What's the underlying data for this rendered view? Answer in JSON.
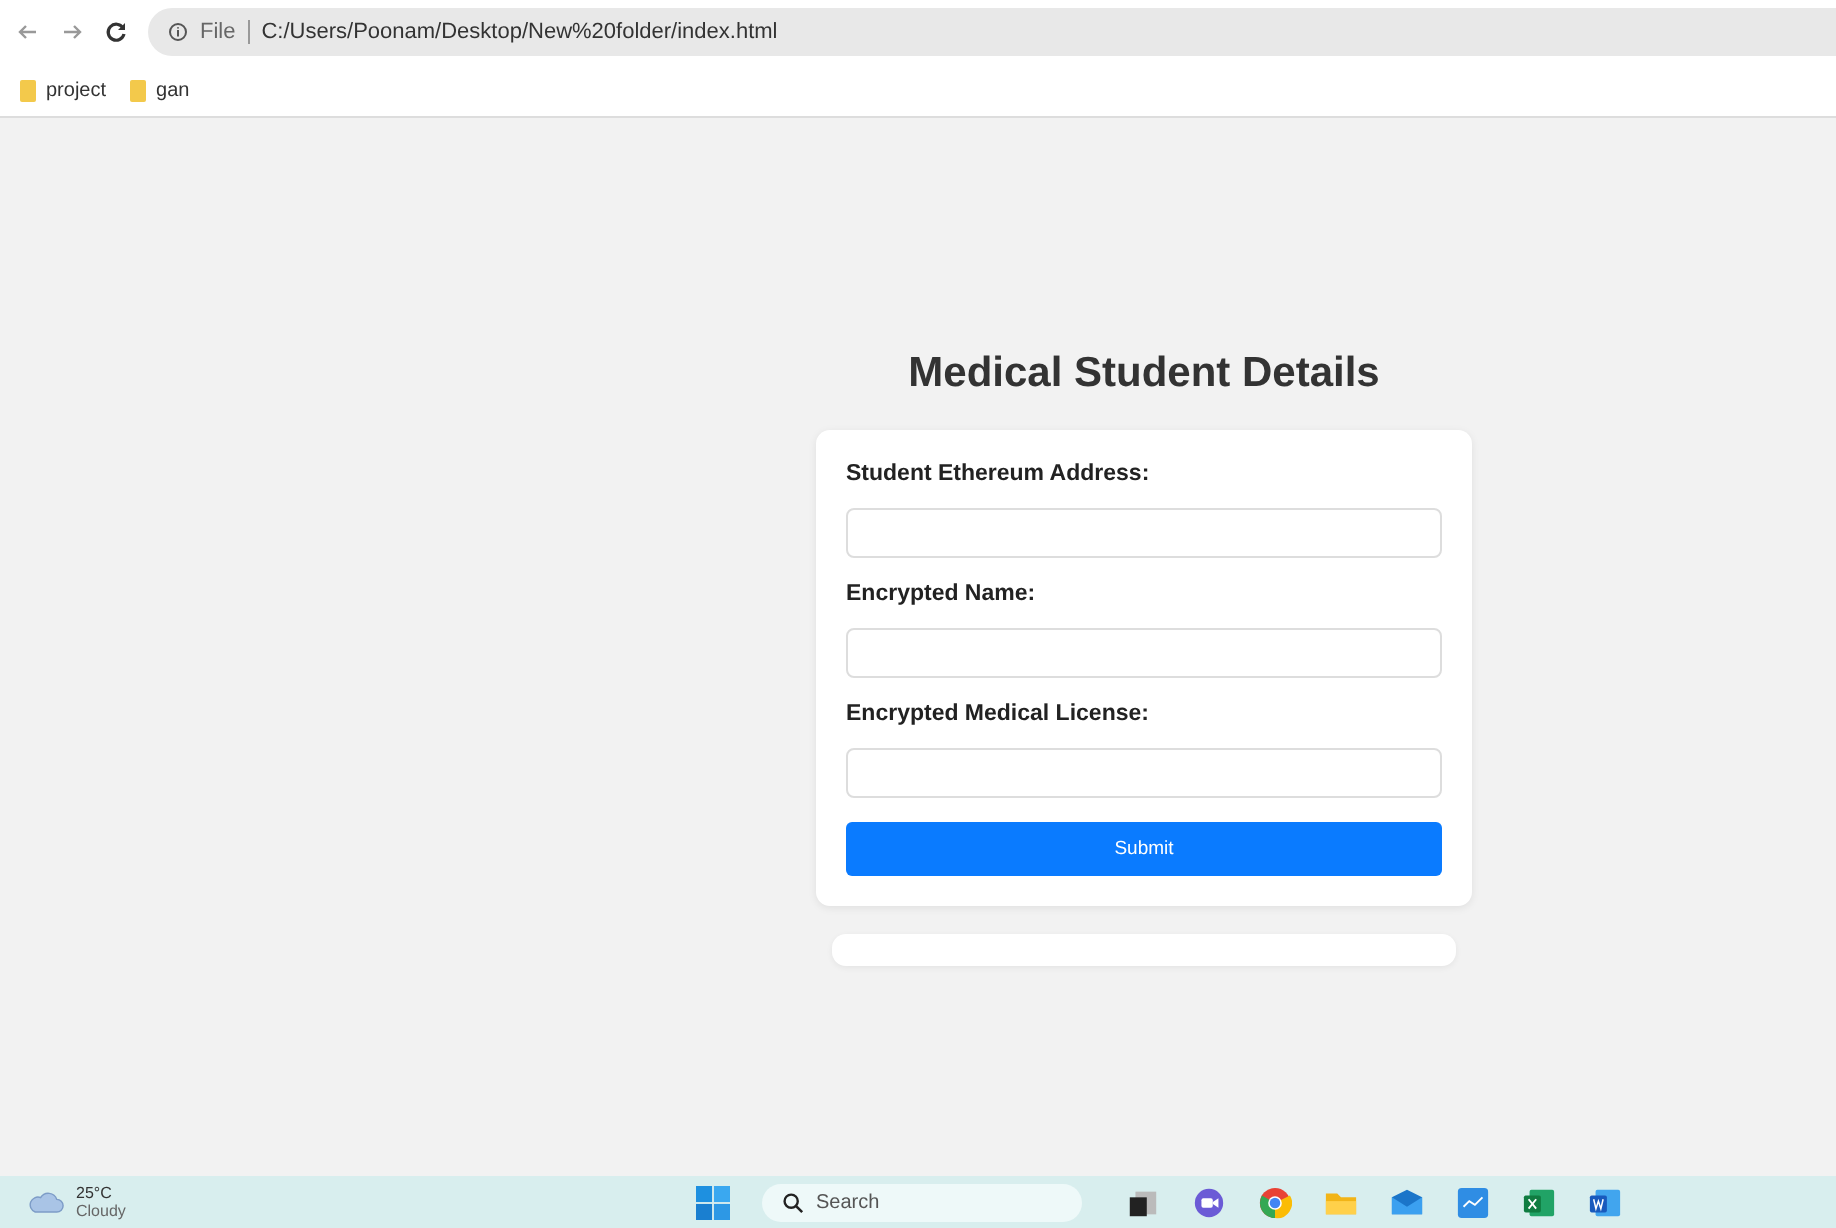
{
  "browser": {
    "scheme": "File",
    "url": "C:/Users/Poonam/Desktop/New%20folder/index.html"
  },
  "bookmarks": [
    "project",
    "gan"
  ],
  "form": {
    "title": "Medical Student Details",
    "fields": [
      {
        "label": "Student Ethereum Address:"
      },
      {
        "label": "Encrypted Name:"
      },
      {
        "label": "Encrypted Medical License:"
      }
    ],
    "submit": "Submit"
  },
  "taskbar": {
    "temperature": "25°C",
    "weather": "Cloudy",
    "search": {
      "placeholder": "Search"
    }
  }
}
